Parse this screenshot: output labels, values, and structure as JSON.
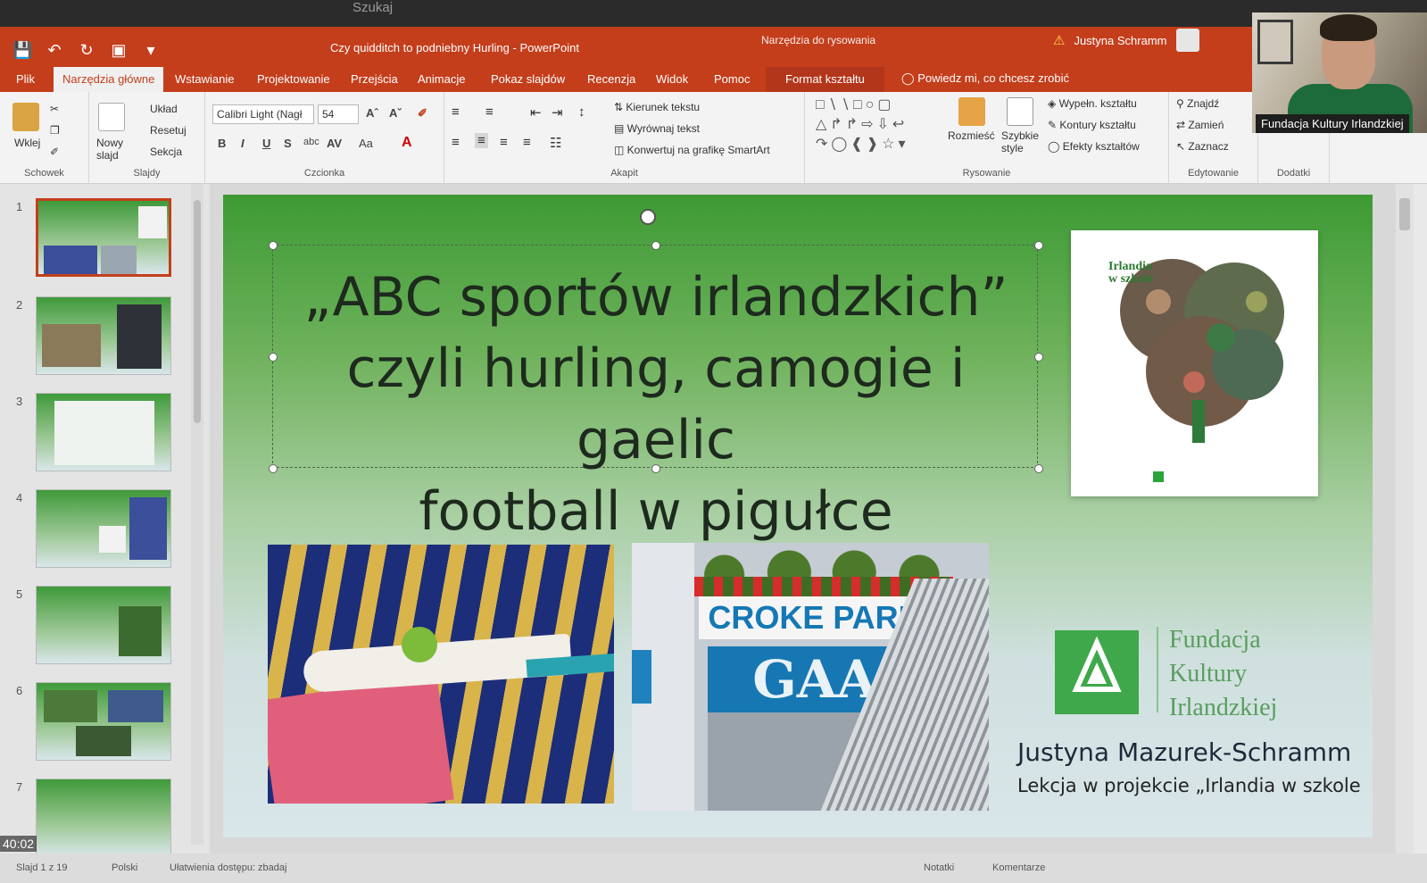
{
  "taskbar": {
    "search": "Szukaj"
  },
  "window": {
    "doc_title": "Czy quidditch to podniebny Hurling - PowerPoint",
    "context_group": "Narzędzia do rysowania",
    "user": "Justyna Schramm",
    "tell_me": "Powiedz mi, co chcesz zrobić"
  },
  "tabs": [
    "Plik",
    "Narzędzia główne",
    "Wstawianie",
    "Projektowanie",
    "Przejścia",
    "Animacje",
    "Pokaz slajdów",
    "Recenzja",
    "Widok",
    "Pomoc",
    "Format kształtu"
  ],
  "ribbon": {
    "clipboard": {
      "paste": "Wklej",
      "label": "Schowek"
    },
    "slides": {
      "new_slide": "Nowy slajd",
      "layout": "Układ",
      "reset": "Resetuj",
      "section": "Sekcja",
      "label": "Slajdy"
    },
    "font": {
      "family": "Calibri Light (Nagł",
      "size": "54",
      "label": "Czcionka",
      "bold": "B",
      "italic": "I",
      "underline": "U",
      "strike": "S",
      "abc": "abc",
      "spacing": "AV",
      "case": "Aa",
      "color": "A"
    },
    "paragraph": {
      "text_direction": "Kierunek tekstu",
      "align_text": "Wyrównaj tekst",
      "smartart": "Konwertuj na grafikę SmartArt",
      "label": "Akapit"
    },
    "drawing": {
      "arrange": "Rozmieść",
      "quick_styles": "Szybkie style",
      "fill": "Wypełn. kształtu",
      "outline": "Kontury kształtu",
      "effects": "Efekty kształtów",
      "label": "Rysowanie"
    },
    "editing": {
      "find": "Znajdź",
      "replace": "Zamień",
      "select": "Zaznacz",
      "label": "Edytowanie"
    },
    "addins": {
      "label": "Dodatki"
    }
  },
  "webcam": {
    "caption": "Fundacja Kultury Irlandzkiej"
  },
  "slides_pane": {
    "numbers": [
      "1",
      "2",
      "3",
      "4",
      "5",
      "6",
      "7"
    ],
    "selected": 1
  },
  "slide": {
    "title_line1": "„ABC sportów irlandzkich”",
    "title_line2": "czyli hurling, camogie i gaelic",
    "title_line3": "football w pigułce",
    "book_title_line1": "Irlandia",
    "book_title_line2": "w szkole",
    "photo2_sign": "CROKE PARK",
    "photo2_gaa": "GAA",
    "org_line1": "Fundacja",
    "org_line2": "Kultury",
    "org_line3": "Irlandzkiej",
    "author": "Justyna Mazurek-Schramm",
    "lesson": "Lekcja w projekcie „Irlandia w szkole"
  },
  "status": {
    "slide_info": "Slajd 1 z 19",
    "language": "Polski",
    "accessibility": "Ułatwienia dostępu: zbadaj",
    "notes": "Notatki",
    "comments": "Komentarze"
  },
  "overlay": {
    "timer": "40:02"
  },
  "colors": {
    "accent": "#c43e1c",
    "slide_green": "#3d9a34",
    "logo_green": "#3ea84a"
  }
}
